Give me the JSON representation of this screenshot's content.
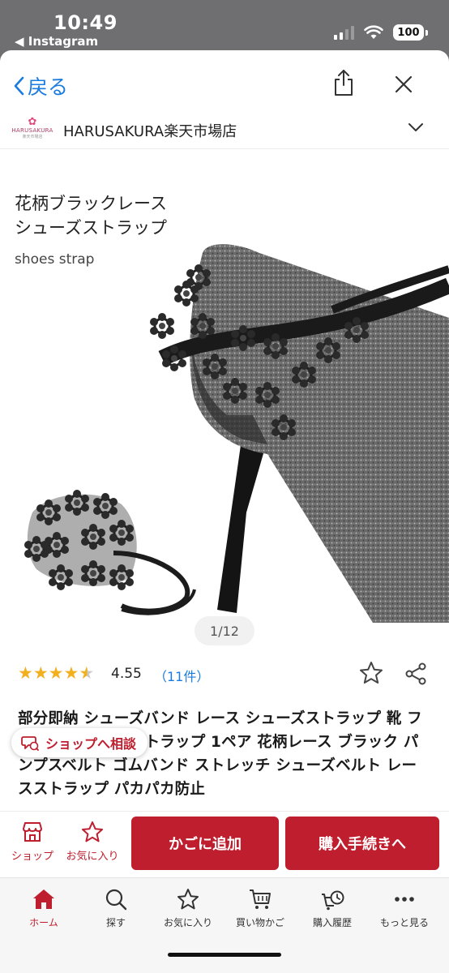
{
  "status_bar": {
    "time": "10:49",
    "back_app": "◀ Instagram",
    "battery": "100"
  },
  "nav": {
    "back_label": "戻る"
  },
  "shop": {
    "name": "HARUSAKURA楽天市場店",
    "logo_text": "HARUSAKURA",
    "logo_sub": "楽天市場店"
  },
  "product_image": {
    "title_line1": "花柄ブラックレース",
    "title_line2": "シューズストラップ",
    "subtitle": "shoes strap",
    "counter": "1/12"
  },
  "rating": {
    "value": "4.55",
    "count": "（11件）",
    "stars": 4.55,
    "max": 5
  },
  "product_title": "部分即納 シューズバンド レース シューズストラップ 靴 フラット パンプスストラップ 1ペア 花柄レース ブラック パンプスベルト ゴムバンド ストレッチ シューズベルト レースストラップ パカパカ防止",
  "chat_button": "ショップへ相談",
  "actions": {
    "shop_label": "ショップ",
    "favorite_label": "お気に入り",
    "cart_button": "かごに追加",
    "buy_button": "購入手続きへ"
  },
  "tabs": [
    {
      "label": "ホーム",
      "icon": "home-icon",
      "active": true
    },
    {
      "label": "探す",
      "icon": "search-icon"
    },
    {
      "label": "お気に入り",
      "icon": "star-icon"
    },
    {
      "label": "買い物かご",
      "icon": "cart-icon"
    },
    {
      "label": "購入履歴",
      "icon": "history-icon"
    },
    {
      "label": "もっと見る",
      "icon": "more-icon"
    }
  ],
  "colors": {
    "accent": "#bf1e2e",
    "link": "#1a7be0",
    "star": "#f2b01e"
  }
}
